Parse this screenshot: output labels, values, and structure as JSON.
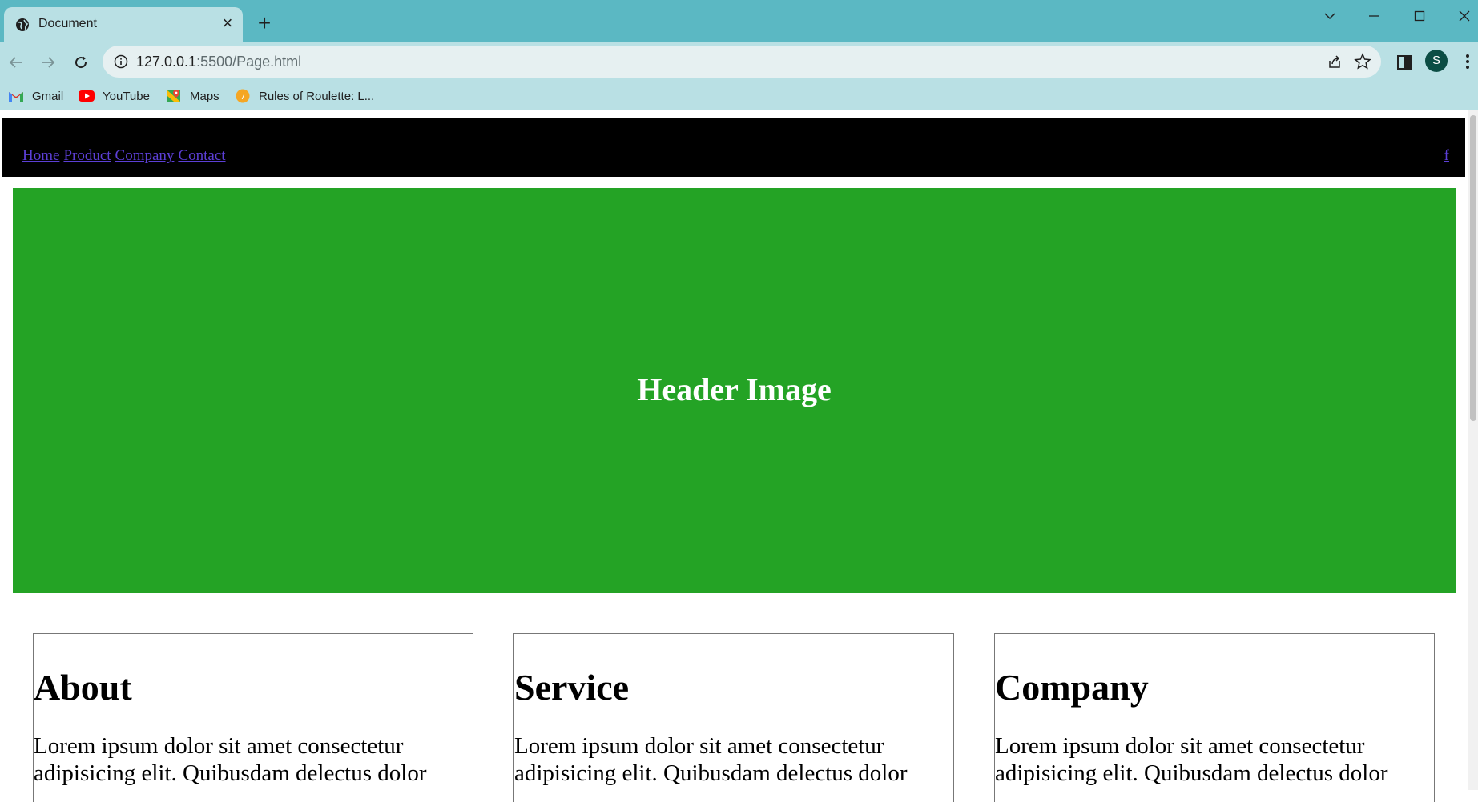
{
  "browser": {
    "tab": {
      "title": "Document",
      "favicon": "globe-icon"
    },
    "url_host": "127.0.0.1",
    "url_path": ":5500/Page.html",
    "profile_initial": "S",
    "bookmarks": [
      {
        "label": "Gmail",
        "icon": "gmail-icon"
      },
      {
        "label": "YouTube",
        "icon": "youtube-icon"
      },
      {
        "label": "Maps",
        "icon": "maps-icon"
      },
      {
        "label": "Rules of Roulette: L...",
        "icon": "roulette-icon"
      }
    ]
  },
  "page": {
    "nav_links": [
      "Home",
      "Product",
      "Company",
      "Contact"
    ],
    "social_link": "f",
    "hero_text": "Header Image",
    "cards": [
      {
        "title": "About",
        "body": "Lorem ipsum dolor sit amet consectetur adipisicing elit. Quibusdam delectus dolor"
      },
      {
        "title": "Service",
        "body": "Lorem ipsum dolor sit amet consectetur adipisicing elit. Quibusdam delectus dolor"
      },
      {
        "title": "Company",
        "body": "Lorem ipsum dolor sit amet consectetur adipisicing elit. Quibusdam delectus dolor"
      }
    ]
  },
  "colors": {
    "titlebar": "#5bb8c3",
    "toolbar": "#b9e0e4",
    "navbar": "#000000",
    "hero": "#24a325",
    "link": "#5c3fd6"
  }
}
